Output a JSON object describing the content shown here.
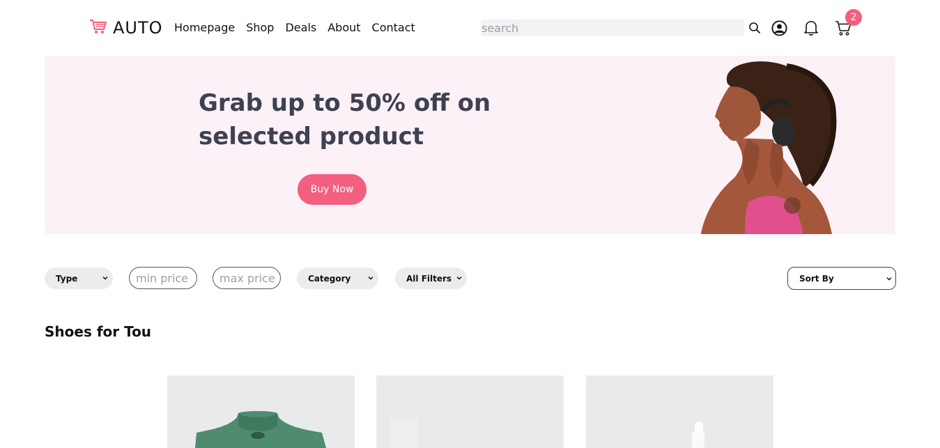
{
  "header": {
    "brand": "AUTO",
    "nav": [
      "Homepage",
      "Shop",
      "Deals",
      "About",
      "Contact"
    ],
    "search_placeholder": "search",
    "cart_count": "2",
    "brand_color": "#f25f7f"
  },
  "hero": {
    "title": "Grab up to 50% off on selected product",
    "button": "Buy Now",
    "background": "#fcf1f7"
  },
  "filters": {
    "type": "Type",
    "min_price_placeholder": "min price",
    "max_price_placeholder": "max price",
    "category": "Category",
    "all_filters": "All Filters",
    "sort_by": "Sort By"
  },
  "section": {
    "title": "Shoes for Tou"
  }
}
